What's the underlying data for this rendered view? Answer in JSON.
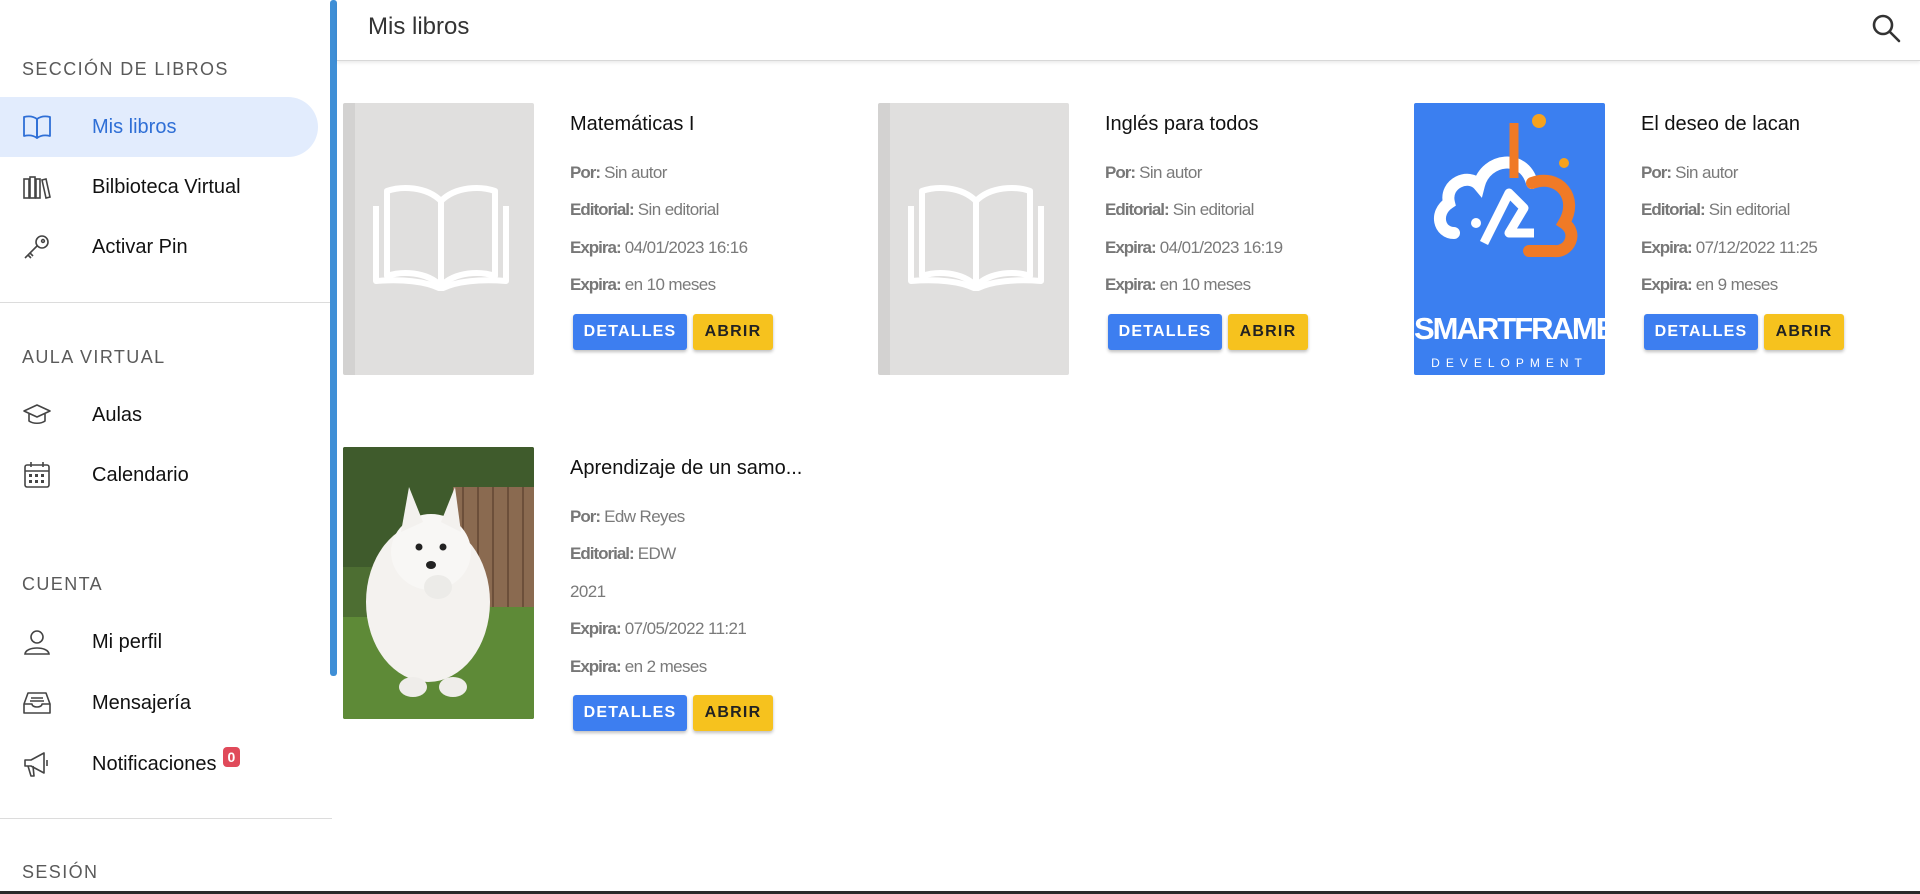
{
  "header": {
    "title": "Mis libros"
  },
  "sidebar": {
    "sections": [
      {
        "title": "SECCIÓN DE LIBROS",
        "items": [
          {
            "label": "Mis libros",
            "icon": "book-open-icon",
            "active": true
          },
          {
            "label": "Bilbioteca Virtual",
            "icon": "library-icon",
            "active": false
          },
          {
            "label": "Activar Pin",
            "icon": "key-icon",
            "active": false
          }
        ]
      },
      {
        "title": "AULA VIRTUAL",
        "items": [
          {
            "label": "Aulas",
            "icon": "graduation-cap-icon",
            "active": false
          },
          {
            "label": "Calendario",
            "icon": "calendar-icon",
            "active": false
          }
        ]
      },
      {
        "title": "CUENTA",
        "items": [
          {
            "label": "Mi perfil",
            "icon": "user-icon",
            "active": false
          },
          {
            "label": "Mensajería",
            "icon": "inbox-icon",
            "active": false
          },
          {
            "label": "Notificaciones",
            "icon": "megaphone-icon",
            "active": false,
            "badge": "0"
          }
        ]
      },
      {
        "title": "SESIÓN",
        "items": []
      }
    ]
  },
  "labels": {
    "por": "Por:",
    "editorial": "Editorial:",
    "expira": "Expira:",
    "details_button": "DETALLES",
    "open_button": "ABRIR"
  },
  "books": [
    {
      "title": "Matemáticas I",
      "author": "Sin autor",
      "publisher": "Sin editorial",
      "expires_date": "04/01/2023 16:16",
      "expires_in": "en 10 meses",
      "cover": "placeholder-book-icon"
    },
    {
      "title": "Inglés para todos",
      "author": "Sin autor",
      "publisher": "Sin editorial",
      "expires_date": "04/01/2023 16:19",
      "expires_in": "en 10 meses",
      "cover": "placeholder-book-icon"
    },
    {
      "title": "El deseo de lacan",
      "author": "Sin autor",
      "publisher": "Sin editorial",
      "expires_date": "07/12/2022 11:25",
      "expires_in": "en 9 meses",
      "cover": "smartframe-logo",
      "cover_text": "SMARTFRAME",
      "cover_subtext": "DEVELOPMENT"
    },
    {
      "title": "Aprendizaje de un samo...",
      "author": "Edw Reyes",
      "publisher": "EDW",
      "year": "2021",
      "expires_date": "07/05/2022 11:21",
      "expires_in": "en 2 meses",
      "cover": "samoyed-dog-photo"
    }
  ],
  "colors": {
    "accent": "#3d7ef0",
    "open_button": "#f6c21e",
    "active_bg": "#e2ecfd",
    "badge": "#e04a5a",
    "scrollbar": "#3f8fd6"
  }
}
